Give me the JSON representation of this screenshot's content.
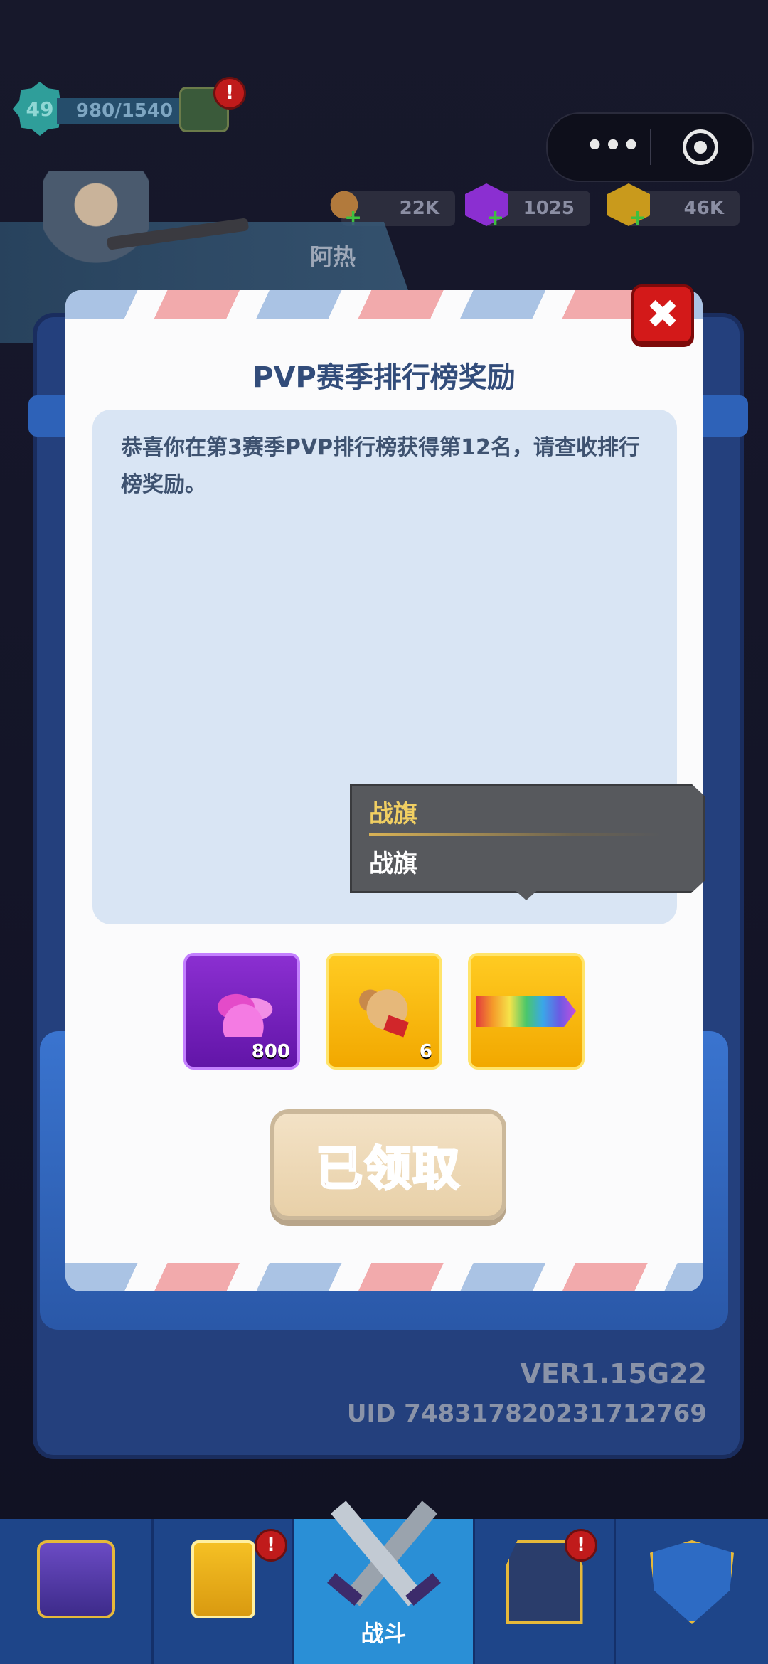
{
  "hud": {
    "level": "49",
    "xp": "980/1540",
    "chest_alert": "!",
    "resources": [
      {
        "name": "wood-icon",
        "value": "22K"
      },
      {
        "name": "purple-gem-icon",
        "value": "1025"
      },
      {
        "name": "gold-coin-icon",
        "value": "46K"
      }
    ],
    "player_name": "阿热"
  },
  "mini_program": {
    "more": "•••"
  },
  "dialog": {
    "title": "PVP赛季排行榜奖励",
    "message": "恭喜你在第3赛季PVP排行榜获得第12名，请查收排行榜奖励。",
    "close": "✖",
    "rewards": [
      {
        "name": "purple-gems",
        "count": "800"
      },
      {
        "name": "scroll",
        "count": "6"
      },
      {
        "name": "war-flag",
        "count": ""
      }
    ],
    "tooltip": {
      "title": "战旗",
      "desc": "战旗"
    },
    "claimed_button": "已领取"
  },
  "footer": {
    "version": "VER1.15G22",
    "uid": "UID 7483178202317127​69"
  },
  "nav": {
    "items": [
      {
        "name": "shop"
      },
      {
        "name": "cards",
        "alert": "!"
      },
      {
        "name": "battle",
        "label": "战斗"
      },
      {
        "name": "tower",
        "alert": "!"
      },
      {
        "name": "alliance"
      }
    ]
  },
  "colors": {
    "accent_blue": "#2a8fd6",
    "title_blue": "#324c7a",
    "alert_red": "#c01b1b",
    "claimed_text": "#a5542a"
  }
}
